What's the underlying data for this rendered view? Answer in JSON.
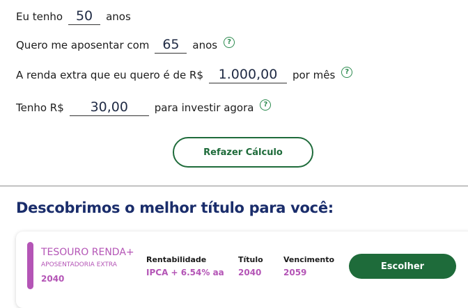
{
  "form": {
    "age": {
      "prefix": "Eu tenho",
      "value": "50",
      "suffix": "anos"
    },
    "retire_age": {
      "prefix": "Quero me aposentar com",
      "value": "65",
      "suffix": "anos"
    },
    "income": {
      "prefix": "A renda extra que eu quero é de R$",
      "value": "1.000,00",
      "suffix": "por mês"
    },
    "invest": {
      "prefix": "Tenho R$",
      "value": "30,00",
      "suffix": "para investir agora"
    },
    "help_glyph": "?",
    "recalc_label": "Refazer Cálculo"
  },
  "result": {
    "heading": "Descobrimos o melhor título para você:",
    "card": {
      "name": "TESOURO RENDA+",
      "subtitle": "APOSENTADORIA EXTRA",
      "year": "2040",
      "columns": [
        {
          "label": "Rentabilidade",
          "value": "IPCA + 6.54% aa"
        },
        {
          "label": "Título",
          "value": "2040"
        },
        {
          "label": "Vencimento",
          "value": "2059"
        }
      ],
      "choose_label": "Escolher"
    }
  },
  "colors": {
    "accent_green": "#1e6b3a",
    "help_green": "#2b8a4e",
    "heading_navy": "#1a2d6b",
    "product_purple": "#b455b6"
  },
  "icons": {
    "help": "help-circle-icon"
  }
}
